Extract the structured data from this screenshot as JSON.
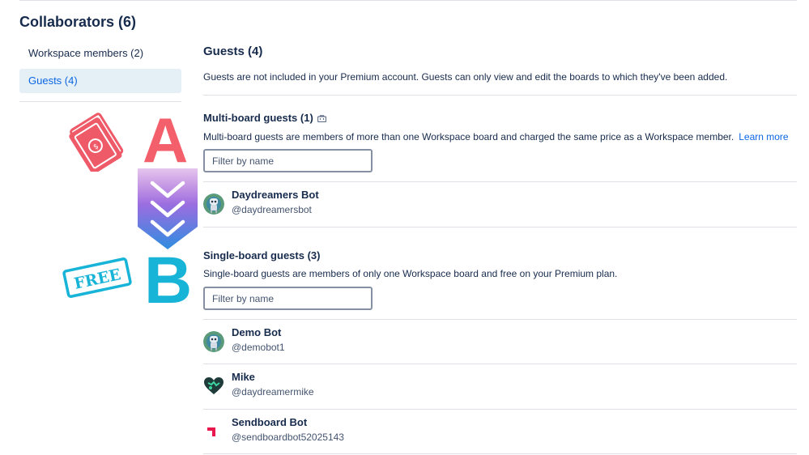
{
  "page": {
    "title": "Collaborators (6)"
  },
  "sidebar": {
    "items": [
      {
        "label": "Workspace members (2)"
      },
      {
        "label": "Guests (4)"
      }
    ]
  },
  "overlay": {
    "letter_a": "A",
    "letter_b": "B",
    "free_stamp": "FREE"
  },
  "main": {
    "title": "Guests (4)",
    "description": "Guests are not included in your Premium account. Guests can only view and edit the boards to which they've been added.",
    "multi": {
      "title": "Multi-board guests (1)",
      "description": "Multi-board guests are members of more than one Workspace board and charged the same price as a Workspace member.",
      "learn_more": "Learn more",
      "filter_placeholder": "Filter by name",
      "members": [
        {
          "name": "Daydreamers Bot",
          "username": "@daydreamersbot",
          "avatar": "robot-avatar"
        }
      ]
    },
    "single": {
      "title": "Single-board guests (3)",
      "description": "Single-board guests are members of only one Workspace board and free on your Premium plan.",
      "filter_placeholder": "Filter by name",
      "members": [
        {
          "name": "Demo Bot",
          "username": "@demobot1",
          "avatar": "robot-avatar"
        },
        {
          "name": "Mike",
          "username": "@daydreamermike",
          "avatar": "heart-avatar"
        },
        {
          "name": "Sendboard Bot",
          "username": "@sendboardbot52025143",
          "avatar": "sendboard-logo"
        }
      ]
    }
  },
  "colors": {
    "accent": "#0c66e4",
    "selected_bg": "#e4f0f6",
    "letter_a": "#f35f6b",
    "letter_b": "#18b4d8",
    "text": "#172b4d"
  }
}
